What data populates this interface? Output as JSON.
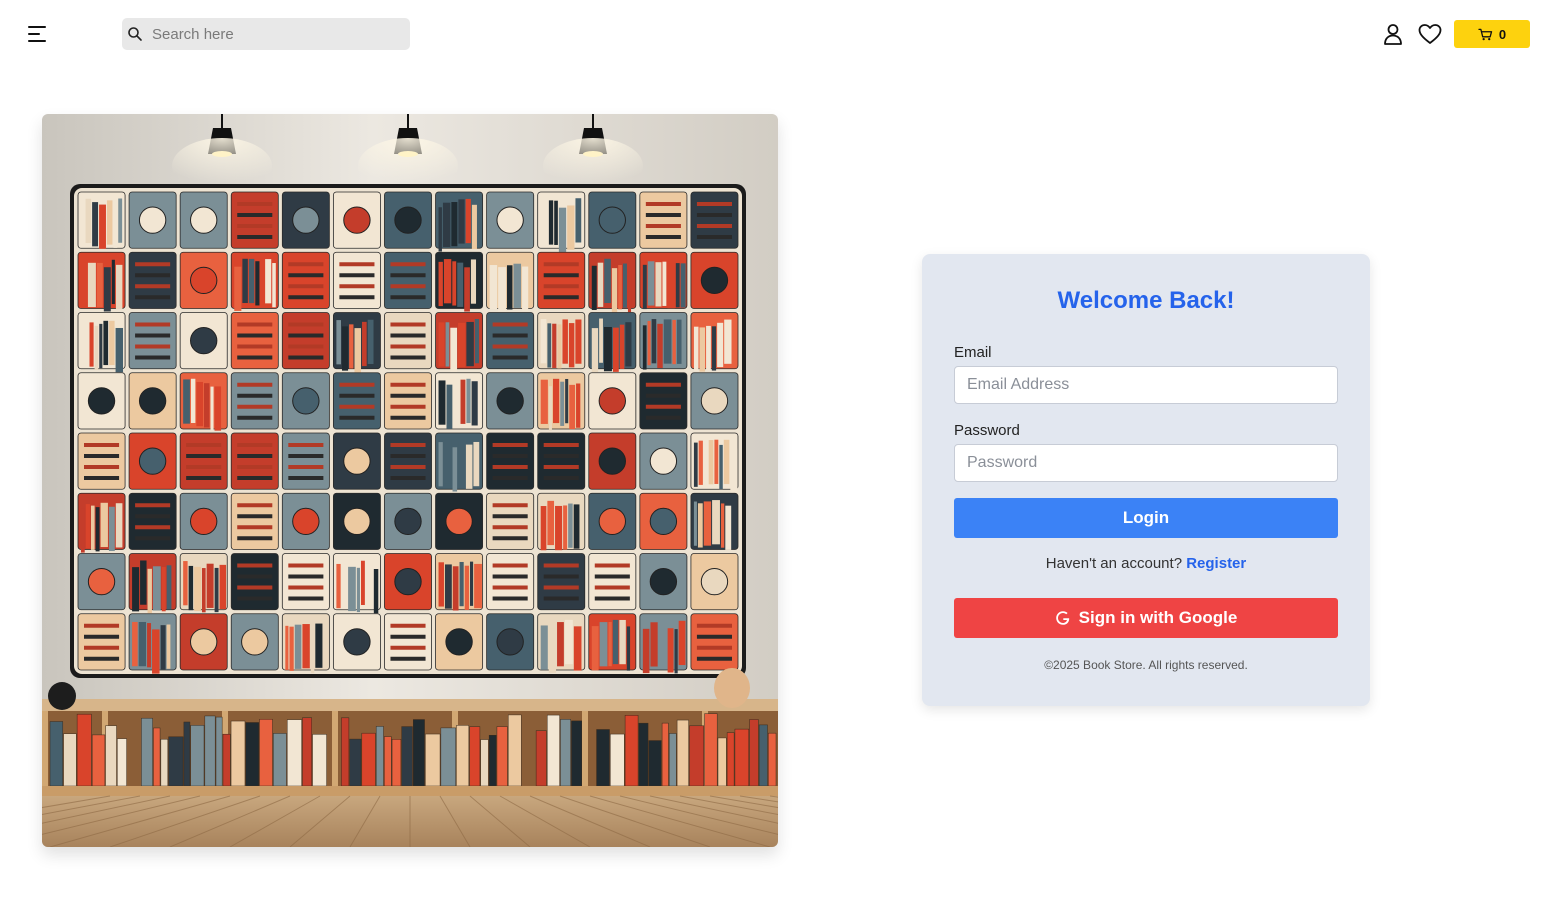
{
  "header": {
    "search_placeholder": "Search here",
    "cart_count": "0"
  },
  "colors": {
    "accent_blue": "#2563eb",
    "login_button": "#3b82f6",
    "google_button": "#ef4444",
    "cart_yellow": "#fdd20e",
    "card_background": "#e2e7f0"
  },
  "icons": {
    "menu": "menu-icon",
    "search": "search-icon",
    "user": "user-icon",
    "favorites": "heart-icon",
    "cart": "cart-icon",
    "google": "google-icon"
  },
  "login": {
    "title": "Welcome Back!",
    "email_label": "Email",
    "email_placeholder": "Email Address",
    "password_label": "Password",
    "password_placeholder": "Password",
    "login_button": "Login",
    "register_prompt": "Haven't an account?",
    "register_link": "Register",
    "google_button": "Sign in with Google",
    "copyright": "©2025 Book Store. All rights reserved."
  }
}
